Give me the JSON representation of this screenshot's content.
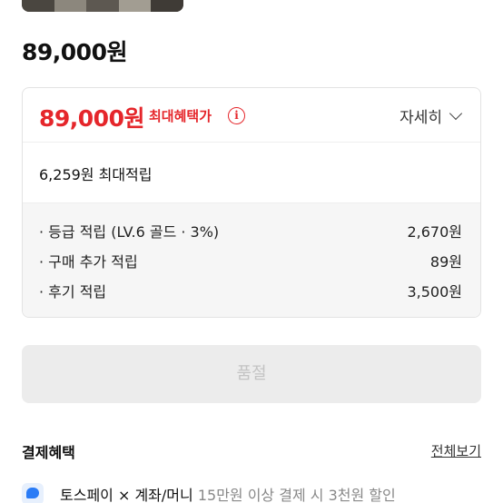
{
  "product": {
    "price": "89,000원"
  },
  "benefit": {
    "max_price": "89,000원",
    "max_label": "최대혜택가",
    "info_icon_glyph": "i",
    "detail_label": "자세히",
    "max_points": "6,259원 최대적립",
    "rows": [
      {
        "label": "· 등급 적립 (LV.6 골드 · 3%)",
        "value": "2,670원"
      },
      {
        "label": "· 구매 추가 적립",
        "value": "89원"
      },
      {
        "label": "· 후기 적립",
        "value": "3,500원"
      }
    ]
  },
  "buy_button": {
    "label": "품절"
  },
  "payment": {
    "title": "결제혜택",
    "see_all": "전체보기",
    "promo": {
      "name": "토스페이 × 계좌/머니",
      "desc": "15만원 이상 결제 시 3천원 할인"
    }
  },
  "colors": {
    "accent_red": "#e5262b",
    "disabled_bg": "#ececec",
    "toss_blue": "#2b7cf6"
  },
  "icons": [
    "info-icon",
    "chevron-down-icon",
    "toss-icon"
  ]
}
